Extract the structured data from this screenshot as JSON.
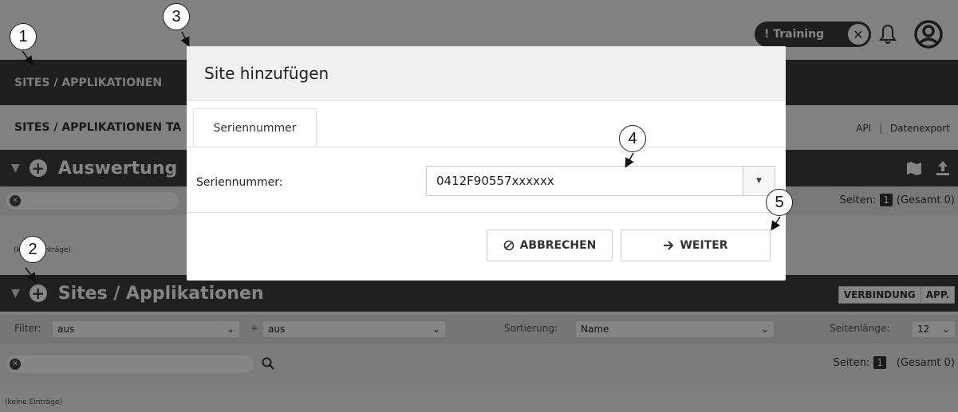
{
  "header": {
    "training_label": "! Training",
    "icons": [
      "close-icon",
      "bell-icon",
      "user-icon"
    ]
  },
  "nav": {
    "active_label": "SITES / APPLIKATIONEN"
  },
  "subnav": {
    "left_label": "SITES / APPLIKATIONEN TA",
    "api_label": "API",
    "separator": "|",
    "export_label": "Datenexport"
  },
  "section1": {
    "title": "Auswertung",
    "note": "(keine Einträge)",
    "pager": {
      "label": "Seiten:",
      "page": "1",
      "total": "(Gesamt 0)"
    }
  },
  "section2": {
    "title": "Sites / Applikationen",
    "toggle": [
      "VERBINDUNG",
      "APP."
    ],
    "filter": {
      "label": "Filter:",
      "value1": "aus",
      "plus": "+",
      "value2": "aus",
      "sort_label": "Sortierung:",
      "sort_value": "Name",
      "pagelen_label": "Seitenlänge:",
      "pagelen_value": "12"
    },
    "pager": {
      "label": "Seiten:",
      "page": "1",
      "total": "(Gesamt 0)"
    },
    "note": "(keine Einträge)"
  },
  "modal": {
    "title": "Site hinzufügen",
    "tab_label": "Seriennummer",
    "field_label": "Seriennummer:",
    "field_value": "0412F90557xxxxxx",
    "cancel_label": "ABBRECHEN",
    "next_label": "WEITER"
  },
  "callouts": [
    "1",
    "2",
    "3",
    "4",
    "5"
  ]
}
